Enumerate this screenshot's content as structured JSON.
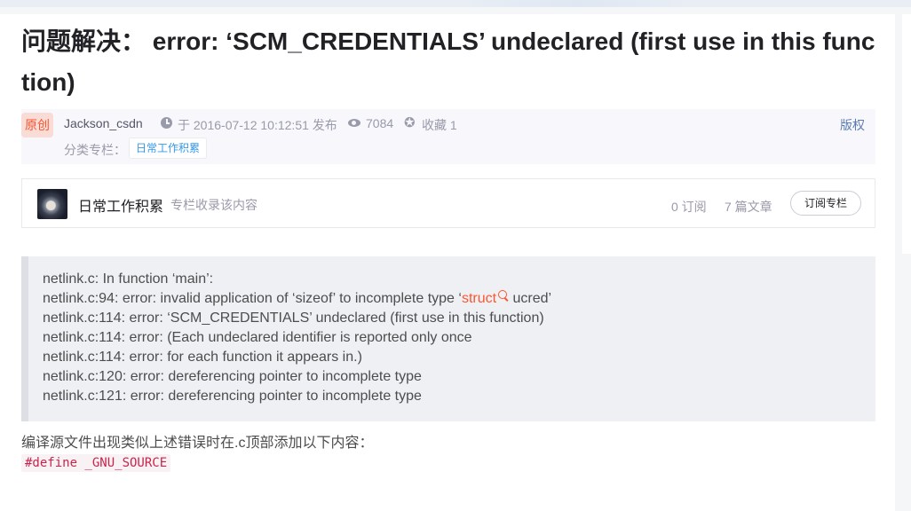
{
  "article": {
    "title": "问题解决： error: ‘SCM_CREDENTIALS’ undeclared (first use in this function)",
    "badge": "原创",
    "author": "Jackson_csdn",
    "publish_time": "于 2016-07-12 10:12:51 发布",
    "views": "7084",
    "favorites": "收藏 1",
    "copyright": "版权",
    "category_label": "分类专栏：",
    "category_tag": "日常工作积累"
  },
  "column": {
    "name": "日常工作积累",
    "description": "专栏收录该内容",
    "subscribers": "0 订阅",
    "articles": "7 篇文章",
    "subscribe_button": "订阅专栏"
  },
  "code": {
    "line1": "netlink.c: In function ‘main’:",
    "line2_pre": "netlink.c:94: error: invalid application of ‘sizeof’ to incomplete type ‘",
    "line2_kw": "struct",
    "line2_post": " ucred’",
    "line3": "netlink.c:114: error: ‘SCM_CREDENTIALS’ undeclared (first use in this function)",
    "line4": "netlink.c:114: error: (Each undeclared identifier is reported only once",
    "line5": "netlink.c:114: error: for each function it appears in.)",
    "line6": "netlink.c:120: error: dereferencing pointer to incomplete type",
    "line7": "netlink.c:121: error: dereferencing pointer to incomplete type"
  },
  "body": {
    "paragraph": "编译源文件出现类似上述错误时在.c顶部添加以下内容：",
    "inline_code": "#define _GNU_SOURCE"
  },
  "icons": {
    "clock": "clock-icon",
    "eye": "eye-icon",
    "star": "star-icon",
    "search": "search-icon"
  },
  "colors": {
    "accent": "#fc5531",
    "link": "#3399ea",
    "code_bg": "#eef0f4"
  }
}
